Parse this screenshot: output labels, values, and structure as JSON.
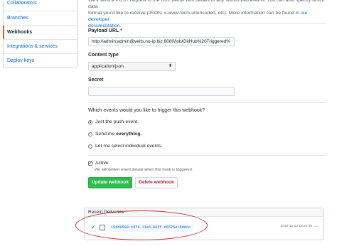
{
  "sidebar": {
    "items": [
      {
        "label": "Collaborators"
      },
      {
        "label": "Branches"
      },
      {
        "label": "Webhooks"
      },
      {
        "label": "Integrations & services"
      },
      {
        "label": "Deploy keys"
      }
    ]
  },
  "intro": {
    "line1": "We'll send a POST request to the URL below with details of any subscribed events. You can also specify which data",
    "line2": "format you'd like to receive (JSON, x-www-form-urlencoded, etc). More information can be found in",
    "link_our": "our developer",
    "link_doc": "documentation"
  },
  "form": {
    "payload_url_label": "Payload URL",
    "payload_url_required": "*",
    "payload_url_value": "http://admin:admin@veits.no-ip.biz:8080/job/GitHub%20Triggered%",
    "content_type_label": "Content type",
    "content_type_value": "application/json",
    "secret_label": "Secret",
    "secret_value": "",
    "events_question": "Which events would you like to trigger this webhook?",
    "radio_push": "Just the push event.",
    "radio_everything_prefix": "Send me",
    "radio_everything_bold": "everything.",
    "radio_individual": "Let me select individual events.",
    "active_label": "Active",
    "active_note": "We will deliver event details when this hook is triggered.",
    "update_button": "Update webhook",
    "delete_button": "Delete webhook"
  },
  "deliveries": {
    "title": "Recent Deliveries",
    "rows": [
      {
        "guid": "15dd0500-c874-11e6-88ff-d5575e15ddcc",
        "time": "2016-12-22 18:20:09",
        "status": "success"
      }
    ]
  },
  "annotation": {
    "color": "#d32f2f"
  }
}
